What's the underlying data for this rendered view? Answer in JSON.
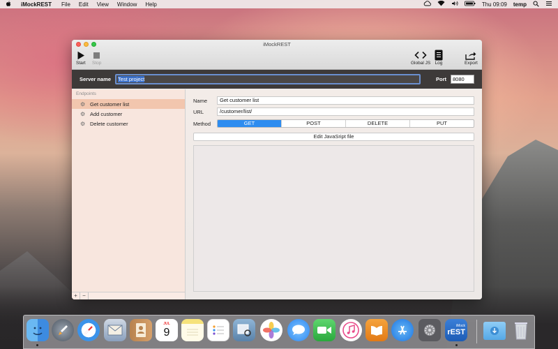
{
  "menubar": {
    "apple_icon": "apple-icon",
    "app_name": "iMockREST",
    "items": [
      "File",
      "Edit",
      "View",
      "Window",
      "Help"
    ],
    "clock": "Thu 09:09",
    "user": "temp"
  },
  "window": {
    "title": "iMockREST",
    "toolbar": {
      "start_label": "Start",
      "stop_label": "Stop",
      "global_js_label": "Global JS",
      "log_label": "Log",
      "export_label": "Export"
    },
    "server": {
      "name_label": "Server name",
      "name_value": "Test project",
      "port_label": "Port",
      "port_value": "8080"
    },
    "sidebar": {
      "header": "Endpoints",
      "items": [
        "Get customer list",
        "Add customer",
        "Delete customer"
      ],
      "selected_index": 0,
      "add_label": "+",
      "remove_label": "−"
    },
    "detail": {
      "name_label": "Name",
      "name_value": "Get customer list",
      "url_label": "URL",
      "url_value": "/customer/list/",
      "method_label": "Method",
      "methods": [
        "GET",
        "POST",
        "DELETE",
        "PUT"
      ],
      "selected_method": "GET",
      "edit_js_label": "Edit JavaSript file"
    }
  },
  "dock": {
    "apps": [
      "finder-icon",
      "launchpad-icon",
      "safari-icon",
      "mail-icon",
      "contacts-icon",
      "calendar-icon",
      "notes-icon",
      "reminders-icon",
      "preview-icon",
      "photos-icon",
      "messages-icon",
      "facetime-icon",
      "itunes-icon",
      "ibooks-icon",
      "app-store-icon",
      "system-preferences-icon",
      "imockrest-icon",
      "downloads-folder-icon",
      "trash-icon"
    ],
    "calendar_month": "JUL",
    "calendar_day": "9",
    "imockrest_label_small": "iMock",
    "imockrest_label_big": "rEST"
  },
  "colors": {
    "accent": "#2e8cf0",
    "server_bar": "#3d3a39",
    "sidebar_selected": "#f2c6ae"
  }
}
